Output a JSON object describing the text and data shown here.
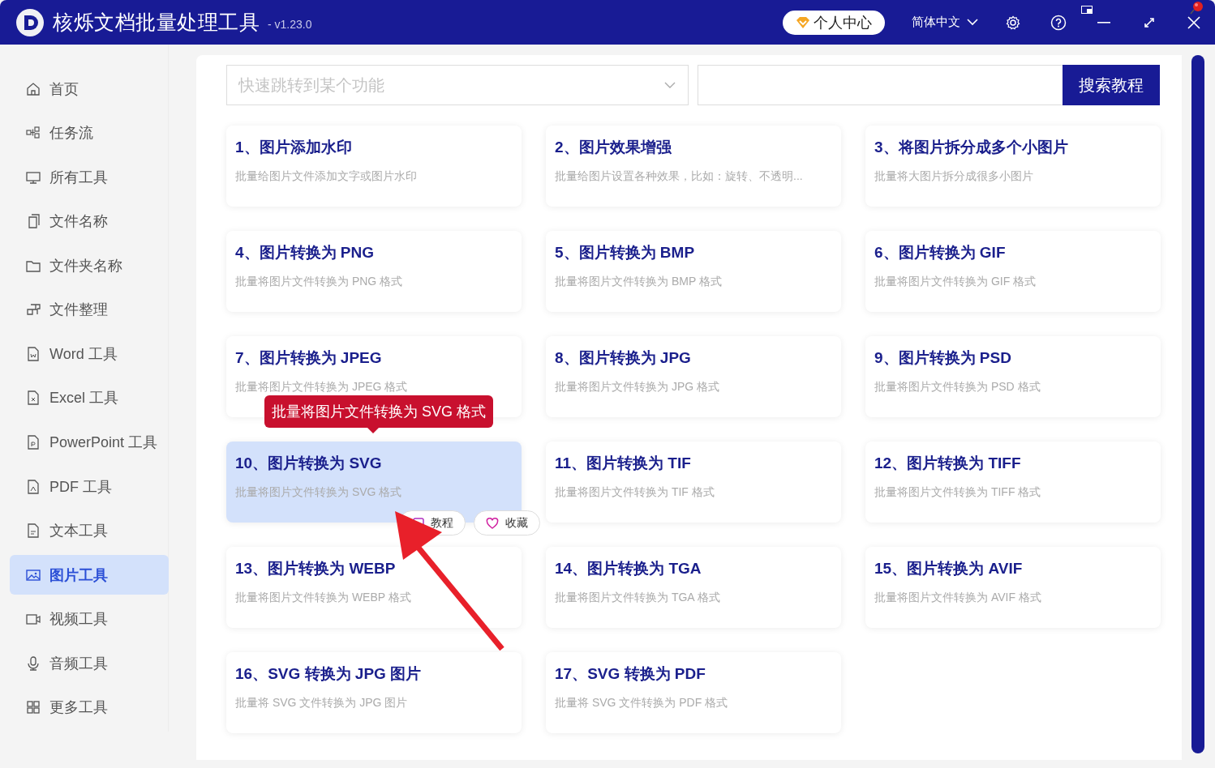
{
  "window": {
    "title": "核烁文档批量处理工具",
    "version": "- v1.23.0"
  },
  "header": {
    "member_button": "个人中心",
    "language": "简体中文"
  },
  "sidebar": {
    "items": [
      {
        "label": "首页",
        "selected": false
      },
      {
        "label": "任务流",
        "selected": false
      },
      {
        "label": "所有工具",
        "selected": false
      },
      {
        "label": "文件名称",
        "selected": false
      },
      {
        "label": "文件夹名称",
        "selected": false
      },
      {
        "label": "文件整理",
        "selected": false
      },
      {
        "label": "Word 工具",
        "selected": false
      },
      {
        "label": "Excel 工具",
        "selected": false
      },
      {
        "label": "PowerPoint 工具",
        "selected": false
      },
      {
        "label": "PDF 工具",
        "selected": false
      },
      {
        "label": "文本工具",
        "selected": false
      },
      {
        "label": "图片工具",
        "selected": true
      },
      {
        "label": "视频工具",
        "selected": false
      },
      {
        "label": "音频工具",
        "selected": false
      },
      {
        "label": "更多工具",
        "selected": false
      }
    ]
  },
  "search": {
    "placeholder": "快速跳转到某个功能",
    "button": "搜索教程"
  },
  "tools": [
    {
      "title": "1、图片添加水印",
      "description": "批量给图片文件添加文字或图片水印",
      "selected": false
    },
    {
      "title": "2、图片效果增强",
      "description": "批量给图片设置各种效果，比如：旋转、不透明...",
      "selected": false
    },
    {
      "title": "3、将图片拆分成多个小图片",
      "description": "批量将大图片拆分成很多小图片",
      "selected": false
    },
    {
      "title": "4、图片转换为 PNG",
      "description": "批量将图片文件转换为 PNG 格式",
      "selected": false
    },
    {
      "title": "5、图片转换为 BMP",
      "description": "批量将图片文件转换为 BMP 格式",
      "selected": false
    },
    {
      "title": "6、图片转换为 GIF",
      "description": "批量将图片文件转换为 GIF 格式",
      "selected": false
    },
    {
      "title": "7、图片转换为 JPEG",
      "description": "批量将图片文件转换为 JPEG 格式",
      "selected": false
    },
    {
      "title": "8、图片转换为 JPG",
      "description": "批量将图片文件转换为 JPG 格式",
      "selected": false
    },
    {
      "title": "9、图片转换为 PSD",
      "description": "批量将图片文件转换为 PSD 格式",
      "selected": false
    },
    {
      "title": "10、图片转换为 SVG",
      "description": "批量将图片文件转换为 SVG 格式",
      "selected": true
    },
    {
      "title": "11、图片转换为 TIF",
      "description": "批量将图片文件转换为 TIF 格式",
      "selected": false
    },
    {
      "title": "12、图片转换为 TIFF",
      "description": "批量将图片文件转换为 TIFF 格式",
      "selected": false
    },
    {
      "title": "13、图片转换为 WEBP",
      "description": "批量将图片文件转换为 WEBP 格式",
      "selected": false
    },
    {
      "title": "14、图片转换为 TGA",
      "description": "批量将图片文件转换为 TGA 格式",
      "selected": false
    },
    {
      "title": "15、图片转换为 AVIF",
      "description": "批量将图片文件转换为 AVIF 格式",
      "selected": false
    },
    {
      "title": "16、SVG 转换为 JPG 图片",
      "description": "批量将 SVG 文件转换为 JPG 图片",
      "selected": false
    },
    {
      "title": "17、SVG 转换为 PDF",
      "description": "批量将 SVG 文件转换为 PDF 格式",
      "selected": false
    }
  ],
  "hover": {
    "tooltip": "批量将图片文件转换为 SVG 格式",
    "tutorial_button": "教程",
    "favorite_button": "收藏"
  }
}
